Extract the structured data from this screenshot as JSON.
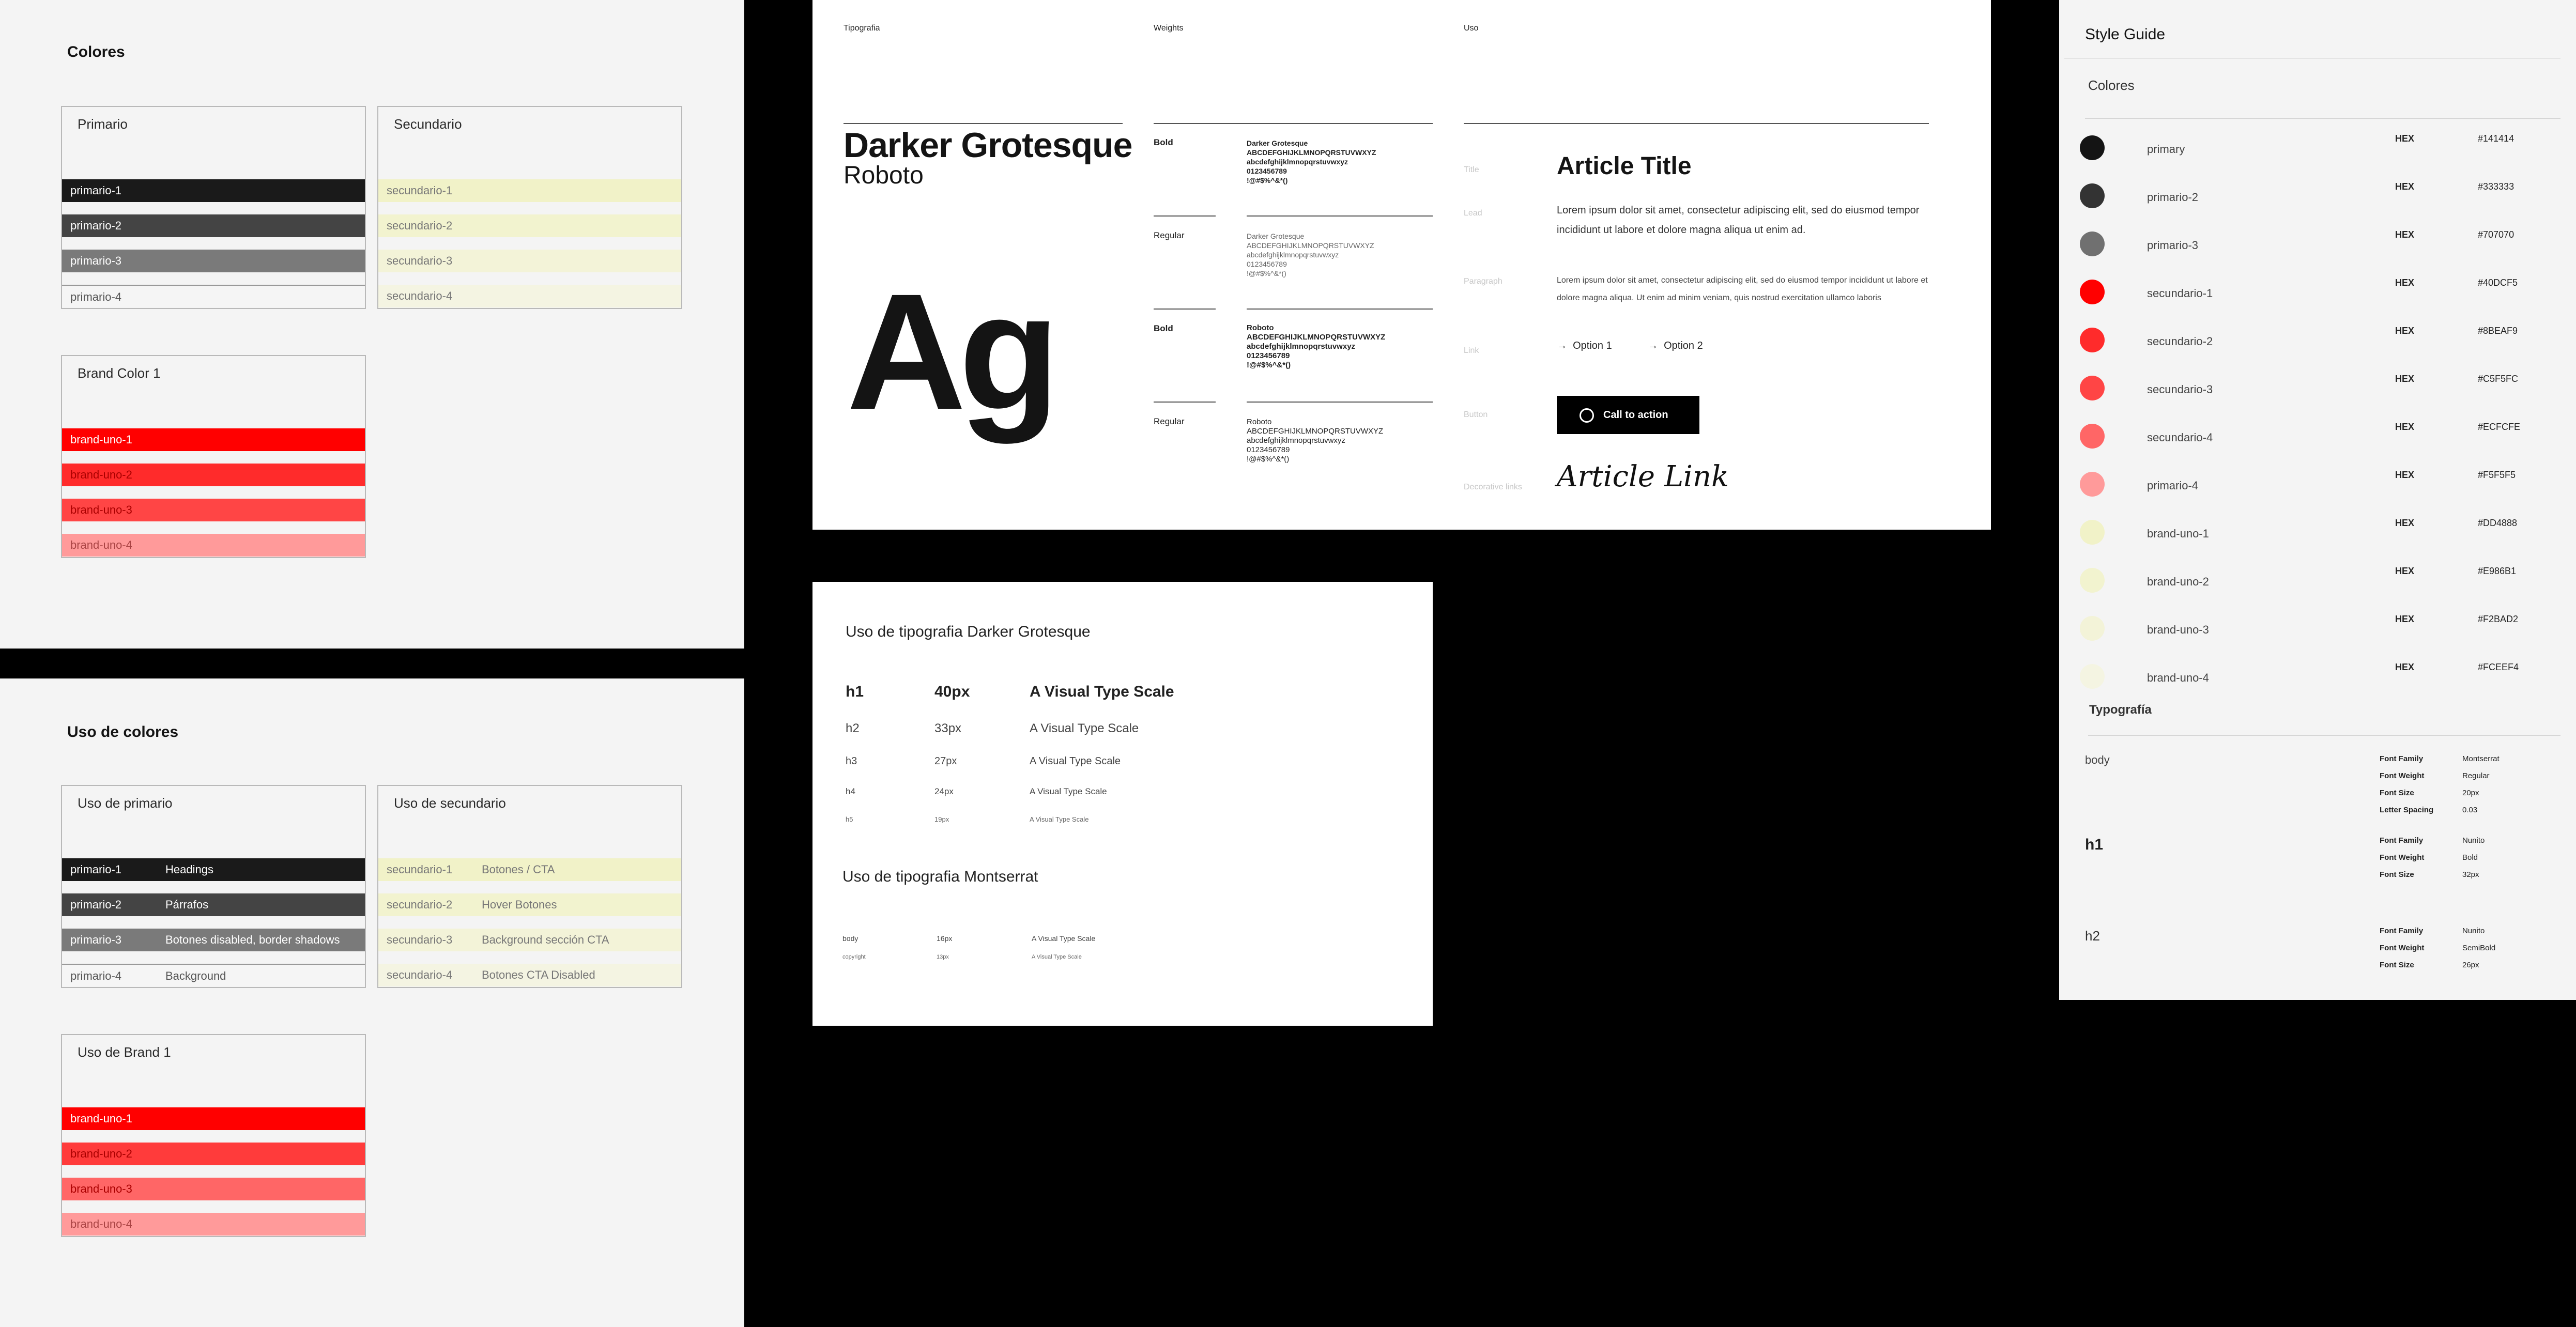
{
  "colores": {
    "title": "Colores",
    "primario": {
      "title": "Primario",
      "swatches": [
        "primario-1",
        "primario-2",
        "primario-3",
        "primario-4"
      ]
    },
    "secundario": {
      "title": "Secundario",
      "swatches": [
        "secundario-1",
        "secundario-2",
        "secundario-3",
        "secundario-4"
      ]
    },
    "brand": {
      "title": "Brand Color 1",
      "swatches": [
        "brand-uno-1",
        "brand-uno-2",
        "brand-uno-3",
        "brand-uno-4"
      ]
    }
  },
  "uso": {
    "title": "Uso de colores",
    "primario": {
      "title": "Uso de primario",
      "rows": [
        {
          "name": "primario-1",
          "use": "Headings"
        },
        {
          "name": "primario-2",
          "use": "Párrafos"
        },
        {
          "name": "primario-3",
          "use": "Botones disabled, border shadows"
        },
        {
          "name": "primario-4",
          "use": "Background"
        }
      ]
    },
    "secundario": {
      "title": "Uso de secundario",
      "rows": [
        {
          "name": "secundario-1",
          "use": "Botones / CTA"
        },
        {
          "name": "secundario-2",
          "use": "Hover Botones"
        },
        {
          "name": "secundario-3",
          "use": "Background sección CTA"
        },
        {
          "name": "secundario-4",
          "use": "Botones CTA Disabled"
        }
      ]
    },
    "brand": {
      "title": "Uso de Brand 1",
      "swatches": [
        "brand-uno-1",
        "brand-uno-2",
        "brand-uno-3",
        "brand-uno-4"
      ]
    }
  },
  "typography": {
    "col_tipografia": "Tipografia",
    "col_weights": "Weights",
    "col_uso": "Uso",
    "font_primary": "Darker Grotesque",
    "font_secondary": "Roboto",
    "specimen": "Ag",
    "weights": [
      {
        "tag": "Bold",
        "name": "Darker Grotesque",
        "upper": "ABCDEFGHIJKLMNOPQRSTUVWXYZ",
        "lower": "abcdefghijklmnopqrstuvwxyz",
        "digits": "0123456789",
        "symbols": "!@#$%^&*()"
      },
      {
        "tag": "Regular",
        "name": "Darker Grotesque",
        "upper": "ABCDEFGHIJKLMNOPQRSTUVWXYZ",
        "lower": "abcdefghijklmnopqrstuvwxyz",
        "digits": "0123456789",
        "symbols": "!@#$%^&*()"
      },
      {
        "tag": "Bold",
        "name": "Roboto",
        "upper": "ABCDEFGHIJKLMNOPQRSTUVWXYZ",
        "lower": "abcdefghijklmnopqrstuvwxyz",
        "digits": "0123456789",
        "symbols": "!@#$%^&*()"
      },
      {
        "tag": "Regular",
        "name": "Roboto",
        "upper": "ABCDEFGHIJKLMNOPQRSTUVWXYZ",
        "lower": "abcdefghijklmnopqrstuvwxyz",
        "digits": "0123456789",
        "symbols": "!@#$%^&*()"
      }
    ],
    "usage": {
      "title_label": "Title",
      "title_text": "Article Title",
      "lead_label": "Lead",
      "lead_text": "Lorem ipsum dolor sit amet, consectetur adipiscing elit, sed do eiusmod tempor incididunt ut labore et dolore magna aliqua ut enim ad.",
      "paragraph_label": "Paragraph",
      "paragraph_text": "Lorem ipsum dolor sit amet, consectetur adipiscing elit, sed do eiusmod tempor incididunt ut labore et dolore magna aliqua. Ut enim ad minim veniam, quis nostrud exercitation ullamco laboris",
      "link_label": "Link",
      "option_1": "Option 1",
      "option_2": "Option 2",
      "button_label": "Button",
      "button_text": "Call to action",
      "deco_label": "Decorative links",
      "deco_text": "Article Link"
    }
  },
  "scale": {
    "title_dg": "Uso de tipografia Darker Grotesque",
    "rows_dg": [
      {
        "tag": "h1",
        "size": "40px",
        "sample": "A Visual Type Scale"
      },
      {
        "tag": "h2",
        "size": "33px",
        "sample": "A Visual Type Scale"
      },
      {
        "tag": "h3",
        "size": "27px",
        "sample": "A Visual Type Scale"
      },
      {
        "tag": "h4",
        "size": "24px",
        "sample": "A Visual Type Scale"
      },
      {
        "tag": "h5",
        "size": "19px",
        "sample": "A Visual Type Scale"
      }
    ],
    "title_ms": "Uso de tipografia Montserrat",
    "rows_ms": [
      {
        "tag": "body",
        "size": "16px",
        "sample": "A Visual Type Scale"
      },
      {
        "tag": "copyright",
        "size": "13px",
        "sample": "A Visual Type Scale"
      }
    ]
  },
  "guide": {
    "title": "Style Guide",
    "colors_title": "Colores",
    "hex_label": "HEX",
    "colors": [
      {
        "name": "primary",
        "hex": "#141414",
        "dot": "#141414"
      },
      {
        "name": "primario-2",
        "hex": "#333333",
        "dot": "#333333"
      },
      {
        "name": "primario-3",
        "hex": "#707070",
        "dot": "#707070"
      },
      {
        "name": "secundario-1",
        "hex": "#40DCF5",
        "dot": "#ff0000"
      },
      {
        "name": "secundario-2",
        "hex": "#8BEAF9",
        "dot": "#ff2b2b"
      },
      {
        "name": "secundario-3",
        "hex": "#C5F5FC",
        "dot": "#ff4545"
      },
      {
        "name": "secundario-4",
        "hex": "#ECFCFE",
        "dot": "#ff6666"
      },
      {
        "name": "primario-4",
        "hex": "#F5F5F5",
        "dot": "#ff9a9a"
      },
      {
        "name": "brand-uno-1",
        "hex": "#DD4888",
        "dot": "#f1f2c8"
      },
      {
        "name": "brand-uno-2",
        "hex": "#E986B1",
        "dot": "#f2f3cf"
      },
      {
        "name": "brand-uno-3",
        "hex": "#F2BAD2",
        "dot": "#f3f3d8"
      },
      {
        "name": "brand-uno-4",
        "hex": "#FCEEF4",
        "dot": "#f4f4e2"
      }
    ],
    "typo_title": "Typografía",
    "typo": [
      {
        "tag": "body",
        "props": [
          [
            "Font Family",
            "Montserrat"
          ],
          [
            "Font Weight",
            "Regular"
          ],
          [
            "Font Size",
            "20px"
          ],
          [
            "Letter Spacing",
            "0.03"
          ]
        ]
      },
      {
        "tag": "h1",
        "props": [
          [
            "Font Family",
            "Nunito"
          ],
          [
            "Font Weight",
            "Bold"
          ],
          [
            "Font Size",
            "32px"
          ]
        ]
      },
      {
        "tag": "h2",
        "props": [
          [
            "Font Family",
            "Nunito"
          ],
          [
            "Font Weight",
            "SemiBold"
          ],
          [
            "Font Size",
            "26px"
          ]
        ]
      }
    ]
  }
}
